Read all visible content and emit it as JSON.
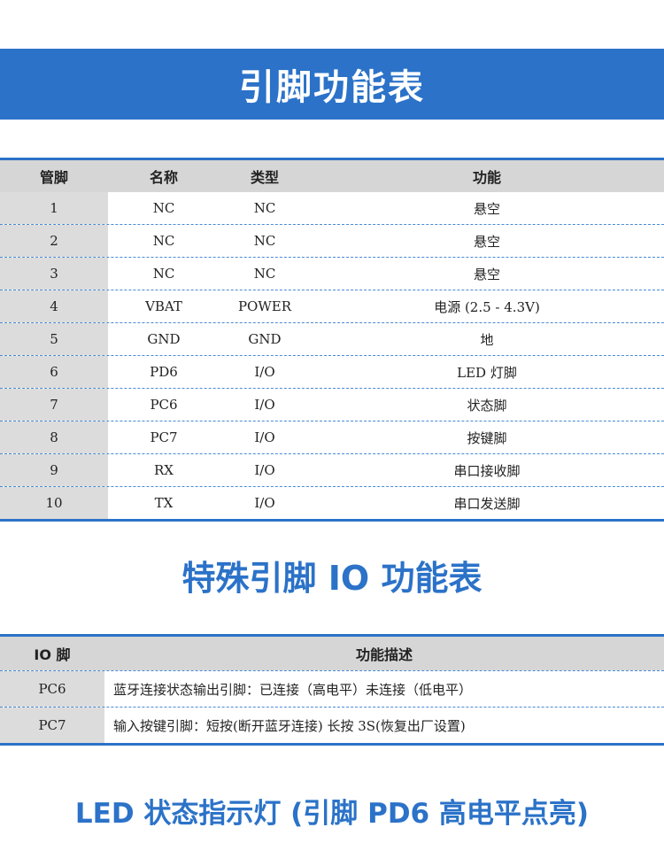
{
  "pin_table": {
    "title": "引脚功能表",
    "headers": [
      "管脚",
      "名称",
      "类型",
      "功能"
    ],
    "rows": [
      [
        "1",
        "NC",
        "NC",
        "悬空"
      ],
      [
        "2",
        "NC",
        "NC",
        "悬空"
      ],
      [
        "3",
        "NC",
        "NC",
        "悬空"
      ],
      [
        "4",
        "VBAT",
        "POWER",
        "电源 (2.5 - 4.3V)"
      ],
      [
        "5",
        "GND",
        "GND",
        "地"
      ],
      [
        "6",
        "PD6",
        "I/O",
        "LED 灯脚"
      ],
      [
        "7",
        "PC6",
        "I/O",
        "状态脚"
      ],
      [
        "8",
        "PC7",
        "I/O",
        "按键脚"
      ],
      [
        "9",
        "RX",
        "I/O",
        "串口接收脚"
      ],
      [
        "10",
        "TX",
        "I/O",
        "串口发送脚"
      ]
    ]
  },
  "io_table": {
    "title": "特殊引脚 IO 功能表",
    "headers": [
      "IO 脚",
      "功能描述"
    ],
    "rows": [
      [
        "PC6",
        "蓝牙连接状态输出引脚：已连接（高电平）未连接（低电平）"
      ],
      [
        "PC7",
        "输入按键引脚：短按(断开蓝牙连接) 长按 3S(恢复出厂设置)"
      ]
    ]
  },
  "led_heading": "LED 状态指示灯 (引脚 PD6 高电平点亮)",
  "colors": {
    "accent": "#2b72c8",
    "header_bg": "#d6d6d6",
    "col_bg": "#dcdcdc"
  }
}
